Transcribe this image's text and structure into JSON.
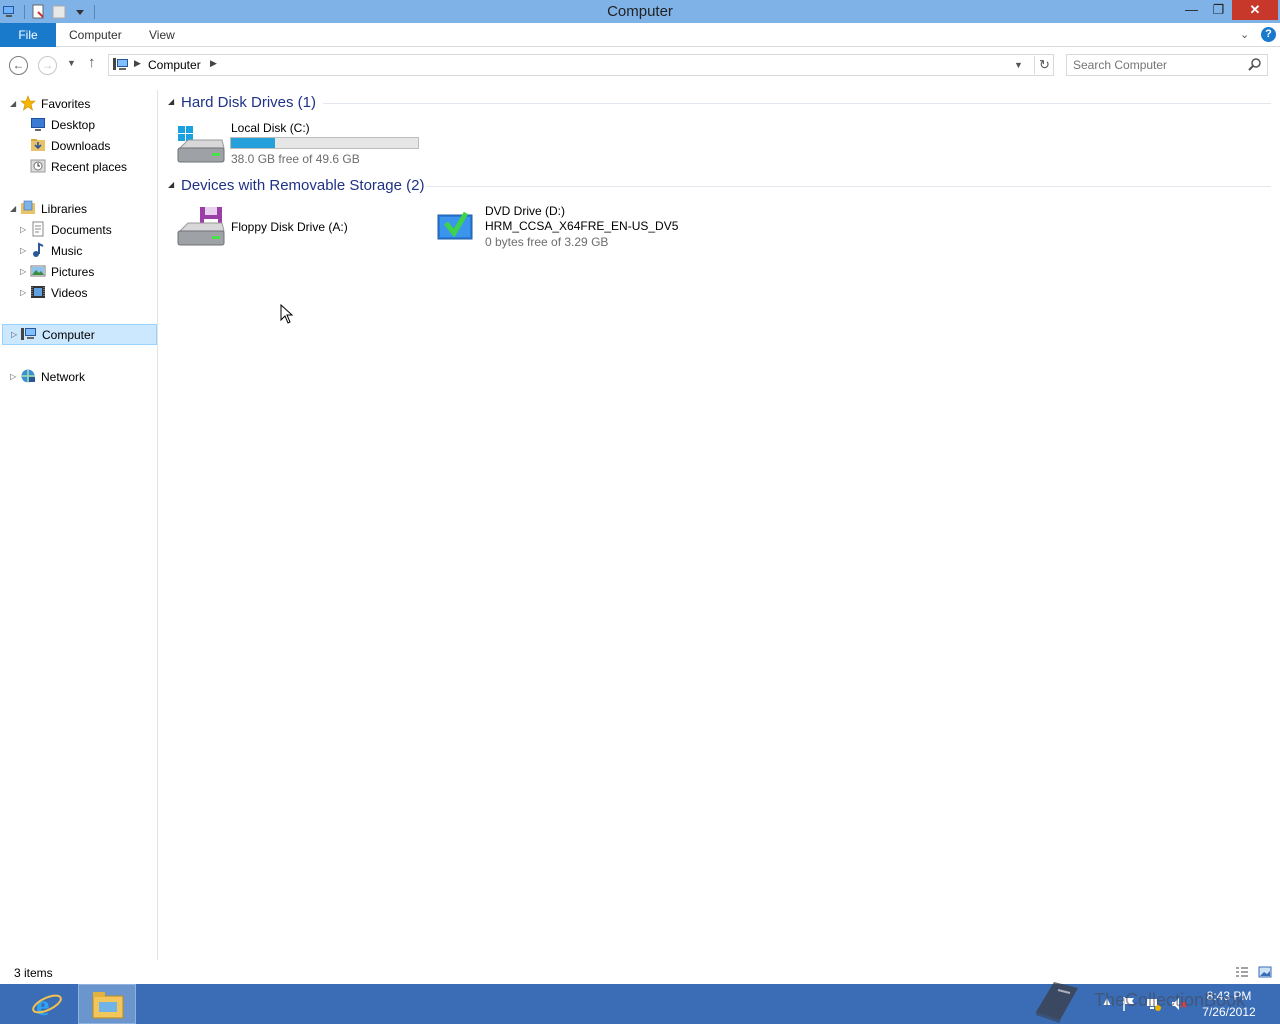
{
  "window": {
    "title": "Computer",
    "min_glyph": "—",
    "max_glyph": "❐",
    "close_glyph": "✕"
  },
  "ribbon": {
    "file": "File",
    "tabs": [
      "Computer",
      "View"
    ],
    "help": "?"
  },
  "address": {
    "crumb": "Computer"
  },
  "search": {
    "placeholder": "Search Computer"
  },
  "nav": {
    "favorites": "Favorites",
    "desktop": "Desktop",
    "downloads": "Downloads",
    "recent": "Recent places",
    "libraries": "Libraries",
    "documents": "Documents",
    "music": "Music",
    "pictures": "Pictures",
    "videos": "Videos",
    "computer": "Computer",
    "network": "Network"
  },
  "groups": {
    "hdd": "Hard Disk Drives (1)",
    "removable": "Devices with Removable Storage (2)"
  },
  "drives": {
    "c": {
      "name": "Local Disk (C:)",
      "free": "38.0 GB free of 49.6 GB",
      "used_fraction": 0.234
    },
    "a": {
      "name": "Floppy Disk Drive (A:)"
    },
    "d": {
      "name": "DVD Drive (D:)",
      "label": "HRM_CCSA_X64FRE_EN-US_DV5",
      "free": "0 bytes free of 3.29 GB"
    }
  },
  "status": {
    "count": "3 items"
  },
  "taskbar": {
    "time": "8:43 PM",
    "date": "7/26/2012",
    "watermark": "TheCollectionBook"
  },
  "colors": {
    "accent": "#1979ca",
    "titlebar": "#7fb3e8",
    "taskbar": "#3a6db5",
    "group_title": "#1e3287",
    "capacity_fill": "#26a0da"
  }
}
